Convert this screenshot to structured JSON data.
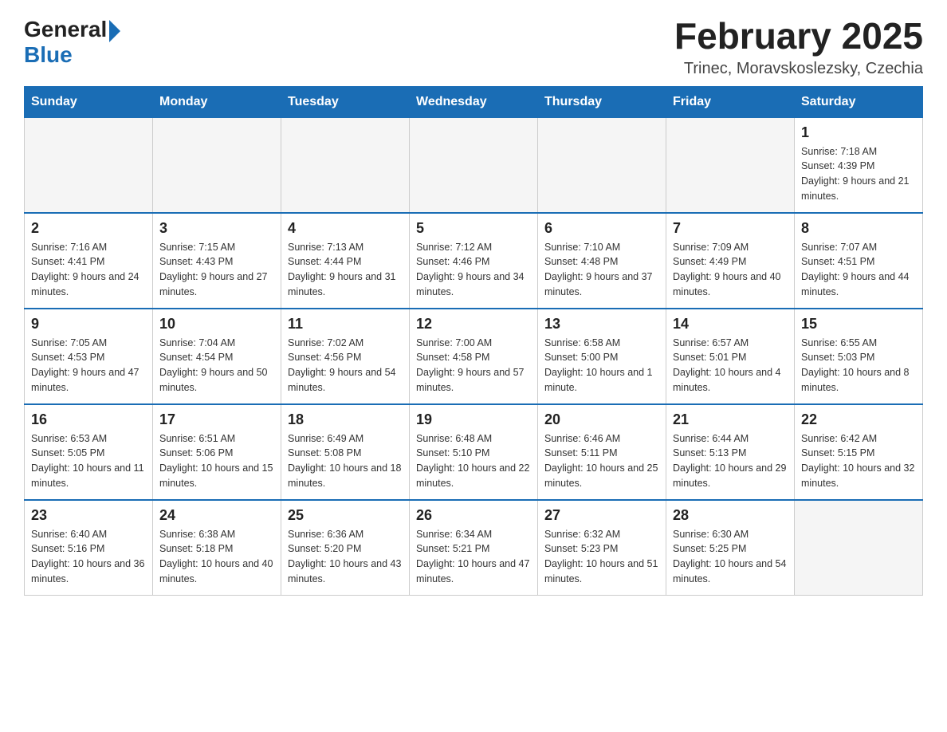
{
  "header": {
    "logo_general": "General",
    "logo_blue": "Blue",
    "month_title": "February 2025",
    "subtitle": "Trinec, Moravskoslezsky, Czechia"
  },
  "weekdays": [
    "Sunday",
    "Monday",
    "Tuesday",
    "Wednesday",
    "Thursday",
    "Friday",
    "Saturday"
  ],
  "weeks": [
    [
      {
        "day": "",
        "info": ""
      },
      {
        "day": "",
        "info": ""
      },
      {
        "day": "",
        "info": ""
      },
      {
        "day": "",
        "info": ""
      },
      {
        "day": "",
        "info": ""
      },
      {
        "day": "",
        "info": ""
      },
      {
        "day": "1",
        "info": "Sunrise: 7:18 AM\nSunset: 4:39 PM\nDaylight: 9 hours and 21 minutes."
      }
    ],
    [
      {
        "day": "2",
        "info": "Sunrise: 7:16 AM\nSunset: 4:41 PM\nDaylight: 9 hours and 24 minutes."
      },
      {
        "day": "3",
        "info": "Sunrise: 7:15 AM\nSunset: 4:43 PM\nDaylight: 9 hours and 27 minutes."
      },
      {
        "day": "4",
        "info": "Sunrise: 7:13 AM\nSunset: 4:44 PM\nDaylight: 9 hours and 31 minutes."
      },
      {
        "day": "5",
        "info": "Sunrise: 7:12 AM\nSunset: 4:46 PM\nDaylight: 9 hours and 34 minutes."
      },
      {
        "day": "6",
        "info": "Sunrise: 7:10 AM\nSunset: 4:48 PM\nDaylight: 9 hours and 37 minutes."
      },
      {
        "day": "7",
        "info": "Sunrise: 7:09 AM\nSunset: 4:49 PM\nDaylight: 9 hours and 40 minutes."
      },
      {
        "day": "8",
        "info": "Sunrise: 7:07 AM\nSunset: 4:51 PM\nDaylight: 9 hours and 44 minutes."
      }
    ],
    [
      {
        "day": "9",
        "info": "Sunrise: 7:05 AM\nSunset: 4:53 PM\nDaylight: 9 hours and 47 minutes."
      },
      {
        "day": "10",
        "info": "Sunrise: 7:04 AM\nSunset: 4:54 PM\nDaylight: 9 hours and 50 minutes."
      },
      {
        "day": "11",
        "info": "Sunrise: 7:02 AM\nSunset: 4:56 PM\nDaylight: 9 hours and 54 minutes."
      },
      {
        "day": "12",
        "info": "Sunrise: 7:00 AM\nSunset: 4:58 PM\nDaylight: 9 hours and 57 minutes."
      },
      {
        "day": "13",
        "info": "Sunrise: 6:58 AM\nSunset: 5:00 PM\nDaylight: 10 hours and 1 minute."
      },
      {
        "day": "14",
        "info": "Sunrise: 6:57 AM\nSunset: 5:01 PM\nDaylight: 10 hours and 4 minutes."
      },
      {
        "day": "15",
        "info": "Sunrise: 6:55 AM\nSunset: 5:03 PM\nDaylight: 10 hours and 8 minutes."
      }
    ],
    [
      {
        "day": "16",
        "info": "Sunrise: 6:53 AM\nSunset: 5:05 PM\nDaylight: 10 hours and 11 minutes."
      },
      {
        "day": "17",
        "info": "Sunrise: 6:51 AM\nSunset: 5:06 PM\nDaylight: 10 hours and 15 minutes."
      },
      {
        "day": "18",
        "info": "Sunrise: 6:49 AM\nSunset: 5:08 PM\nDaylight: 10 hours and 18 minutes."
      },
      {
        "day": "19",
        "info": "Sunrise: 6:48 AM\nSunset: 5:10 PM\nDaylight: 10 hours and 22 minutes."
      },
      {
        "day": "20",
        "info": "Sunrise: 6:46 AM\nSunset: 5:11 PM\nDaylight: 10 hours and 25 minutes."
      },
      {
        "day": "21",
        "info": "Sunrise: 6:44 AM\nSunset: 5:13 PM\nDaylight: 10 hours and 29 minutes."
      },
      {
        "day": "22",
        "info": "Sunrise: 6:42 AM\nSunset: 5:15 PM\nDaylight: 10 hours and 32 minutes."
      }
    ],
    [
      {
        "day": "23",
        "info": "Sunrise: 6:40 AM\nSunset: 5:16 PM\nDaylight: 10 hours and 36 minutes."
      },
      {
        "day": "24",
        "info": "Sunrise: 6:38 AM\nSunset: 5:18 PM\nDaylight: 10 hours and 40 minutes."
      },
      {
        "day": "25",
        "info": "Sunrise: 6:36 AM\nSunset: 5:20 PM\nDaylight: 10 hours and 43 minutes."
      },
      {
        "day": "26",
        "info": "Sunrise: 6:34 AM\nSunset: 5:21 PM\nDaylight: 10 hours and 47 minutes."
      },
      {
        "day": "27",
        "info": "Sunrise: 6:32 AM\nSunset: 5:23 PM\nDaylight: 10 hours and 51 minutes."
      },
      {
        "day": "28",
        "info": "Sunrise: 6:30 AM\nSunset: 5:25 PM\nDaylight: 10 hours and 54 minutes."
      },
      {
        "day": "",
        "info": ""
      }
    ]
  ]
}
